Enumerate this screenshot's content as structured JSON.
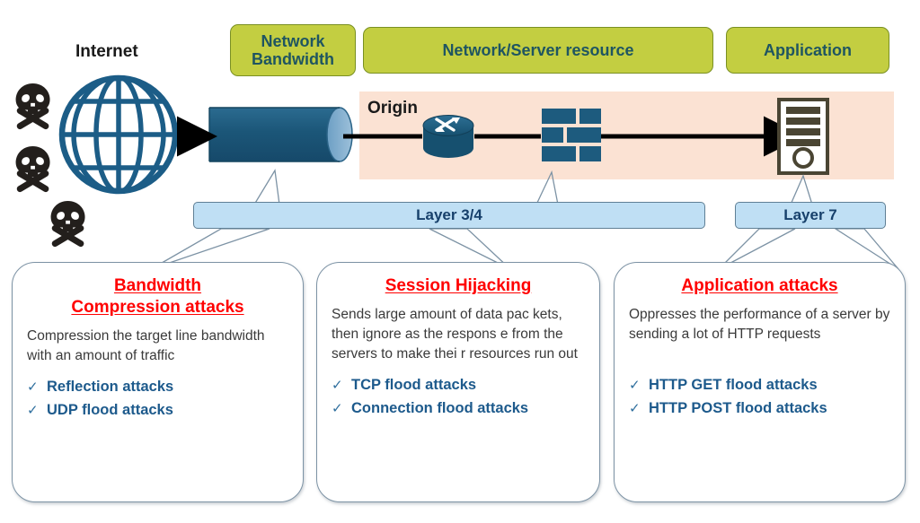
{
  "diagram": {
    "title": "DDoS attack types by layer",
    "colors": {
      "category_fill": "#c3ce41",
      "category_border": "#7a9023",
      "category_text": "#1f5561",
      "band_fill": "#fbe2d3",
      "layer_fill": "#bfdff4",
      "layer_border": "#5f7f95",
      "layer_text": "#17406b",
      "callout_border": "#7d93a5",
      "callout_title": "#ff0000",
      "bullet_text": "#1d5a8c",
      "device_blue": "#1d5b7e",
      "globe_blue": "#1c5d87",
      "skull_black": "#231f1c",
      "server_olive": "#4a4533"
    }
  },
  "categories": [
    {
      "id": "network-bandwidth",
      "label": "Network\nBandwidth"
    },
    {
      "id": "network-server-resource",
      "label": "Network/Server resource"
    },
    {
      "id": "application",
      "label": "Application"
    }
  ],
  "topology": {
    "internet_label": "Internet",
    "origin_label": "Origin",
    "nodes": [
      {
        "id": "skull-1",
        "icon": "skull-crossbones-icon"
      },
      {
        "id": "skull-2",
        "icon": "skull-crossbones-icon"
      },
      {
        "id": "skull-3",
        "icon": "skull-crossbones-icon"
      },
      {
        "id": "globe",
        "icon": "globe-icon"
      },
      {
        "id": "pipe",
        "icon": "bandwidth-pipe-icon"
      },
      {
        "id": "router",
        "icon": "router-icon"
      },
      {
        "id": "firewall",
        "icon": "firewall-icon"
      },
      {
        "id": "server",
        "icon": "server-icon"
      }
    ]
  },
  "layers": [
    {
      "id": "layer-3-4",
      "label": "Layer 3/4"
    },
    {
      "id": "layer-7",
      "label": "Layer 7"
    }
  ],
  "callouts": [
    {
      "id": "bandwidth-compression-attacks",
      "title": "Bandwidth\nCompression attacks",
      "description": "Compression the target line bandwidth with an amount of traffic",
      "bullets": [
        "Reflection attacks",
        "UDP flood attacks"
      ]
    },
    {
      "id": "session-hijacking",
      "title": "Session Hijacking",
      "description": "Sends large amount of data pac kets, then ignore as the respons e from the servers to make thei r resources run out",
      "bullets": [
        "TCP flood attacks",
        "Connection flood attacks"
      ]
    },
    {
      "id": "application-attacks",
      "title": "Application attacks",
      "description": "Oppresses the performance of a server by sending a lot of HTTP requests",
      "bullets": [
        "HTTP GET flood attacks",
        "HTTP POST flood attacks"
      ]
    }
  ],
  "icons": {
    "check": "✓"
  }
}
